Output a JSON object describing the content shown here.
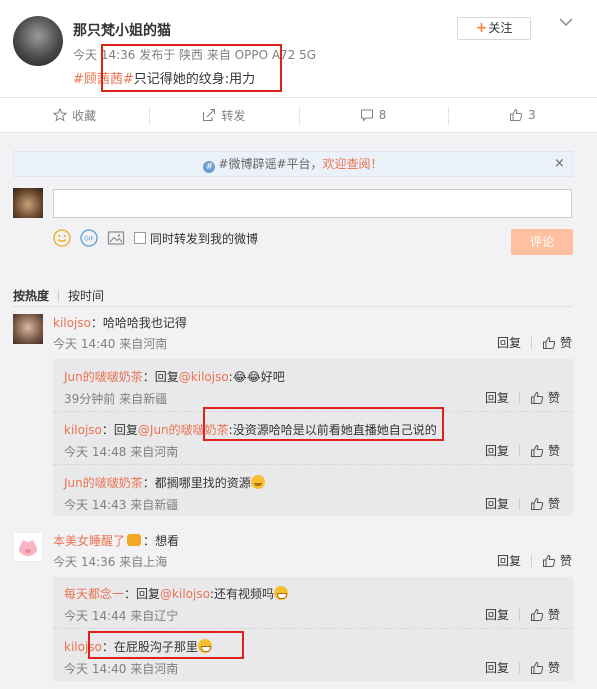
{
  "post": {
    "author": "那只梵小姐的猫",
    "time": "今天 14:36 发布于 陕西 来自 OPPO A72 5G",
    "topic": "#顾茜茜#",
    "text": "只记得她的纹身:用力",
    "follow_label": "关注"
  },
  "actions": {
    "favorite": "收藏",
    "repost": "转发",
    "comments": "8",
    "likes": "3"
  },
  "notice": {
    "prefix": "#微博辟谣#平台，",
    "link": "欢迎查阅！",
    "close": "×"
  },
  "composer": {
    "repost_option": "同时转发到我的微博",
    "submit": "评论"
  },
  "sort": {
    "hot": "按热度",
    "time": "按时间"
  },
  "reply_label": "回复",
  "like_label": "赞",
  "comments": [
    {
      "user": "kilojso",
      "text": "：哈哈哈我也记得",
      "time": "今天 14:40 来自河南",
      "replies": [
        {
          "user": "Jun的啵啵奶茶",
          "prefix": "：回复",
          "mention": "@kilojso",
          "text": ":😂😂好吧",
          "time": "39分钟前 来自新疆"
        },
        {
          "user": "kilojso",
          "prefix": "：回复",
          "mention": "@Jun的啵啵奶茶",
          "text": ":没资源哈哈是以前看她直播她自己说的",
          "time": "今天 14:48 来自河南"
        },
        {
          "user": "Jun的啵啵奶茶",
          "prefix": "：都搁哪里找的资源",
          "mention": "",
          "text": "",
          "time": "今天 14:43 来自新疆"
        }
      ]
    },
    {
      "user": "本美女睡醒了",
      "text": "：想看",
      "time": "今天 14:36 来自上海",
      "replies": [
        {
          "user": "每天都念一",
          "prefix": "：回复",
          "mention": "@kilojso",
          "text": ":还有视频吗",
          "time": "今天 14:44 来自辽宁"
        },
        {
          "user": "kilojso",
          "prefix": "：在屁股沟子那里",
          "mention": "",
          "text": "",
          "time": "今天 14:40 来自河南"
        }
      ]
    }
  ]
}
